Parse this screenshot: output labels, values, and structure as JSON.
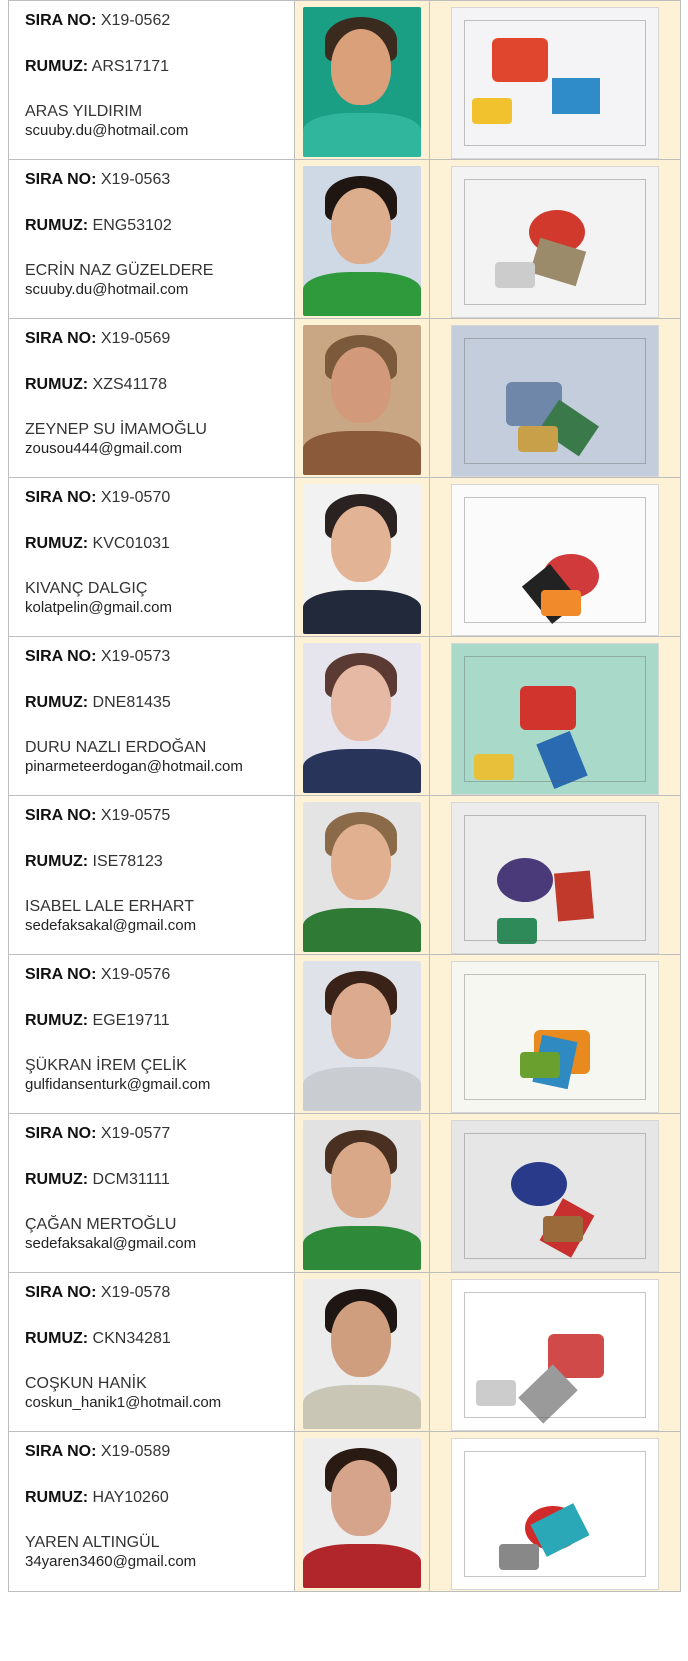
{
  "labels": {
    "sira": "SIRA NO:",
    "rumuz": "RUMUZ:"
  },
  "entries": [
    {
      "sira_no": "X19-0562",
      "rumuz": "ARS17171",
      "name": "ARAS YILDIRIM",
      "email": "scuuby.du@hotmail.com",
      "photo": {
        "bg": "#1a9e84",
        "skin": "#d9a07a",
        "hair": "#3b2a1e",
        "shirt": "#2fb69c"
      },
      "drawing": {
        "bg": "#f4f4f6",
        "accent": "#e0462e",
        "accent2": "#2f8cc9",
        "accent3": "#f2c12e"
      }
    },
    {
      "sira_no": "X19-0563",
      "rumuz": "ENG53102",
      "name": "ECRİN NAZ GÜZELDERE",
      "email": "scuuby.du@hotmail.com",
      "photo": {
        "bg": "#cfd9e6",
        "skin": "#dcae8e",
        "hair": "#1f1612",
        "shirt": "#2f9a3c"
      },
      "drawing": {
        "bg": "#f3f3f3",
        "accent": "#d0392b",
        "accent2": "#9c8b6a",
        "accent3": "#cccccc"
      }
    },
    {
      "sira_no": "X19-0569",
      "rumuz": "XZS41178",
      "name": "ZEYNEP SU İMAMOĞLU",
      "email": "zousou444@gmail.com",
      "photo": {
        "bg": "#c9a684",
        "skin": "#d29a7a",
        "hair": "#7a5a3a",
        "shirt": "#8a5a3a"
      },
      "drawing": {
        "bg": "#c3cddb",
        "accent": "#6f87a8",
        "accent2": "#3a7a4a",
        "accent3": "#c9a04a"
      }
    },
    {
      "sira_no": "X19-0570",
      "rumuz": "KVC01031",
      "name": "KIVANÇ DALGIÇ",
      "email": "kolatpelin@gmail.com",
      "photo": {
        "bg": "#f2f2f2",
        "skin": "#e2b394",
        "hair": "#2a2220",
        "shirt": "#22293a"
      },
      "drawing": {
        "bg": "#fbfbfb",
        "accent": "#d03a3a",
        "accent2": "#222222",
        "accent3": "#f08a2a"
      }
    },
    {
      "sira_no": "X19-0573",
      "rumuz": "DNE81435",
      "name": "DURU NAZLI ERDOĞAN",
      "email": "pinarmeteerdogan@hotmail.com",
      "photo": {
        "bg": "#e6e4ec",
        "skin": "#e6b9a4",
        "hair": "#5a3a32",
        "shirt": "#28345a"
      },
      "drawing": {
        "bg": "#a9d9c9",
        "accent": "#d0342c",
        "accent2": "#2a6ab0",
        "accent3": "#e8c03a"
      }
    },
    {
      "sira_no": "X19-0575",
      "rumuz": "ISE78123",
      "name": "ISABEL LALE ERHART",
      "email": "sedefaksakal@gmail.com",
      "photo": {
        "bg": "#e4e4e4",
        "skin": "#e0b090",
        "hair": "#8a6a48",
        "shirt": "#2f7a34"
      },
      "drawing": {
        "bg": "#ececec",
        "accent": "#4a3a7a",
        "accent2": "#c0392b",
        "accent3": "#2f8a5a"
      }
    },
    {
      "sira_no": "X19-0576",
      "rumuz": "EGE19711",
      "name": "ŞÜKRAN İREM ÇELİK",
      "email": "gulfidansenturk@gmail.com",
      "photo": {
        "bg": "#dfe2e8",
        "skin": "#dcaa8e",
        "hair": "#3a2218",
        "shirt": "#c9cdd2"
      },
      "drawing": {
        "bg": "#f7f7f2",
        "accent": "#e88a1e",
        "accent2": "#2e8ac0",
        "accent3": "#6aa02e"
      }
    },
    {
      "sira_no": "X19-0577",
      "rumuz": "DCM31111",
      "name": "ÇAĞAN MERTOĞLU",
      "email": "sedefaksakal@gmail.com",
      "photo": {
        "bg": "#e2e2e2",
        "skin": "#d8a888",
        "hair": "#4a3020",
        "shirt": "#2e8a38"
      },
      "drawing": {
        "bg": "#e6e6e6",
        "accent": "#2a3a8a",
        "accent2": "#c83030",
        "accent3": "#9a6a3a"
      }
    },
    {
      "sira_no": "X19-0578",
      "rumuz": "CKN34281",
      "name": "COŞKUN HANİK",
      "email": "coskun_hanik1@hotmail.com",
      "photo": {
        "bg": "#ececec",
        "skin": "#cf9e7e",
        "hair": "#1e1612",
        "shirt": "#c9c6b6"
      },
      "drawing": {
        "bg": "#ffffff",
        "accent": "#d04a4a",
        "accent2": "#9a9a9a",
        "accent3": "#cccccc"
      }
    },
    {
      "sira_no": "X19-0589",
      "rumuz": "HAY10260",
      "name": "YAREN ALTINGÜL",
      "email": "34yaren3460@gmail.com",
      "photo": {
        "bg": "#ededed",
        "skin": "#d6a48a",
        "hair": "#2a1a14",
        "shirt": "#b0262a"
      },
      "drawing": {
        "bg": "#ffffff",
        "accent": "#d02a2a",
        "accent2": "#2aa8b8",
        "accent3": "#888888"
      }
    }
  ]
}
